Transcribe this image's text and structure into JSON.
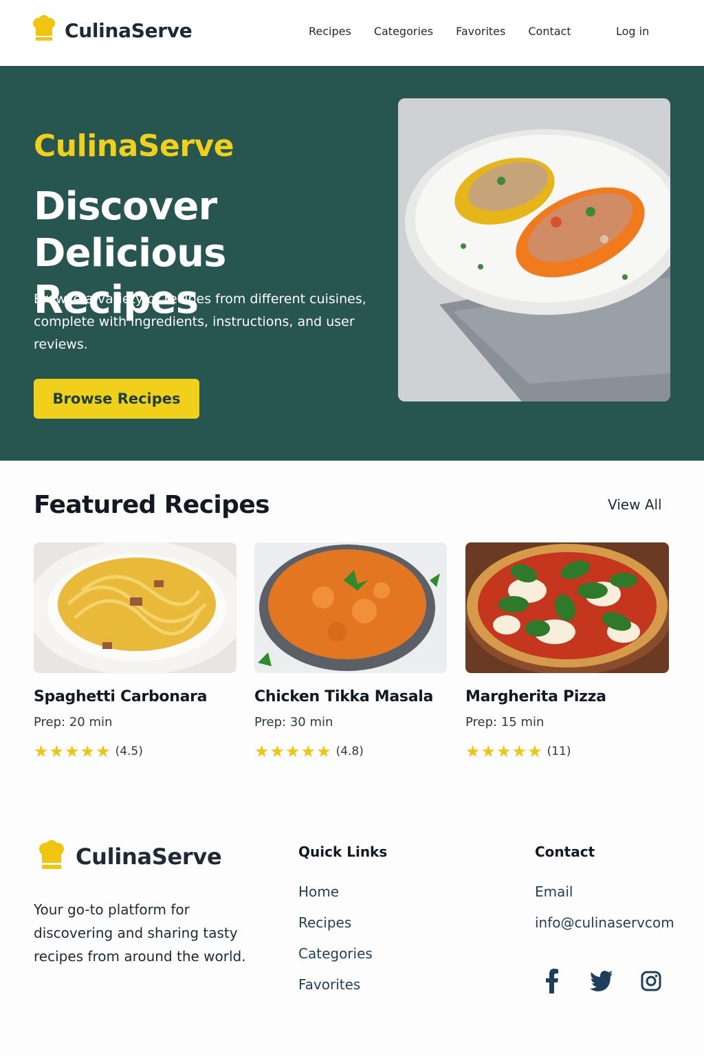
{
  "brand": {
    "name": "CulinaServe"
  },
  "nav": {
    "items": [
      "Recipes",
      "Categories",
      "Favorites",
      "Contact"
    ],
    "login_label": "Log in"
  },
  "hero": {
    "kicker": "CulinaServe",
    "headline": "Discover Delicious Recipes",
    "description": "Browse a variety of recipes from different cuisines, complete with ingredients, instructions, and user reviews.",
    "cta_label": "Browse Recipes"
  },
  "featured": {
    "title": "Featured Recipes",
    "view_all_label": "View All",
    "recipes": [
      {
        "title": "Spaghetti Carbonara",
        "prep": "Prep: 20 min",
        "stars": "★★★★★",
        "score": "(4.5)"
      },
      {
        "title": "Chicken Tikka Masala",
        "prep": "Prep: 30 min",
        "stars": "★★★★★",
        "score": "(4.8)"
      },
      {
        "title": "Margherita Pizza",
        "prep": "Prep: 15 min",
        "stars": "★★★★★",
        "score": "(11)"
      }
    ]
  },
  "footer": {
    "brand_name": "CulinaServe",
    "description": "Your go-to platform for discovering and sharing tasty recipes from around the world.",
    "quick_links": {
      "title": "Quick Links",
      "items": [
        "Home",
        "Recipes",
        "Categories",
        "Favorites"
      ]
    },
    "contact": {
      "title": "Contact",
      "items": [
        "Email",
        "info@culinaservcom"
      ]
    },
    "socials": [
      "facebook-icon",
      "twitter-icon",
      "instagram-icon"
    ]
  },
  "colors": {
    "hero_bg": "#275550",
    "accent_yellow": "#f1d01b",
    "dark_text": "#1b2a35",
    "link_blue": "#1e3f5a",
    "star": "#f1c40f"
  }
}
